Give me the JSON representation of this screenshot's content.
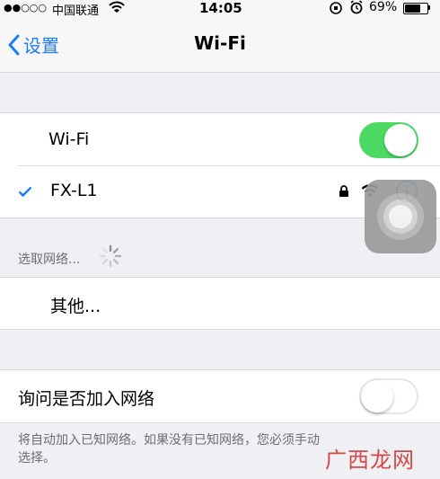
{
  "status_bar": {
    "signal": "●●○○○",
    "carrier": "中国联通",
    "time": "14:05",
    "battery_percent": "69%",
    "battery_level": 0.69,
    "icons": [
      "wifi-signal-icon",
      "rotation-lock-icon",
      "alarm-icon",
      "battery-icon"
    ]
  },
  "nav": {
    "back_label": "设置",
    "title": "Wi-Fi",
    "accent_color": "#1e7cf6"
  },
  "wifi_toggle": {
    "label": "Wi-Fi",
    "on": true,
    "on_color": "#4cd964"
  },
  "connected_network": {
    "name": "FX-L1",
    "icons": [
      "checkmark-icon",
      "lock-icon",
      "wifi-signal-icon",
      "info-icon"
    ]
  },
  "networks_section": {
    "header": "选取网络...",
    "icons": [
      "loading-spinner-icon"
    ],
    "other_label": "其他..."
  },
  "ask_to_join": {
    "label": "询问是否加入网络",
    "on": false,
    "footer": "将自动加入已知网络。如果没有已知网络，您必须手动选择。"
  },
  "overlay": {
    "icons": [
      "assistive-touch-icon"
    ]
  },
  "watermark": {
    "text": "广西龙网"
  }
}
